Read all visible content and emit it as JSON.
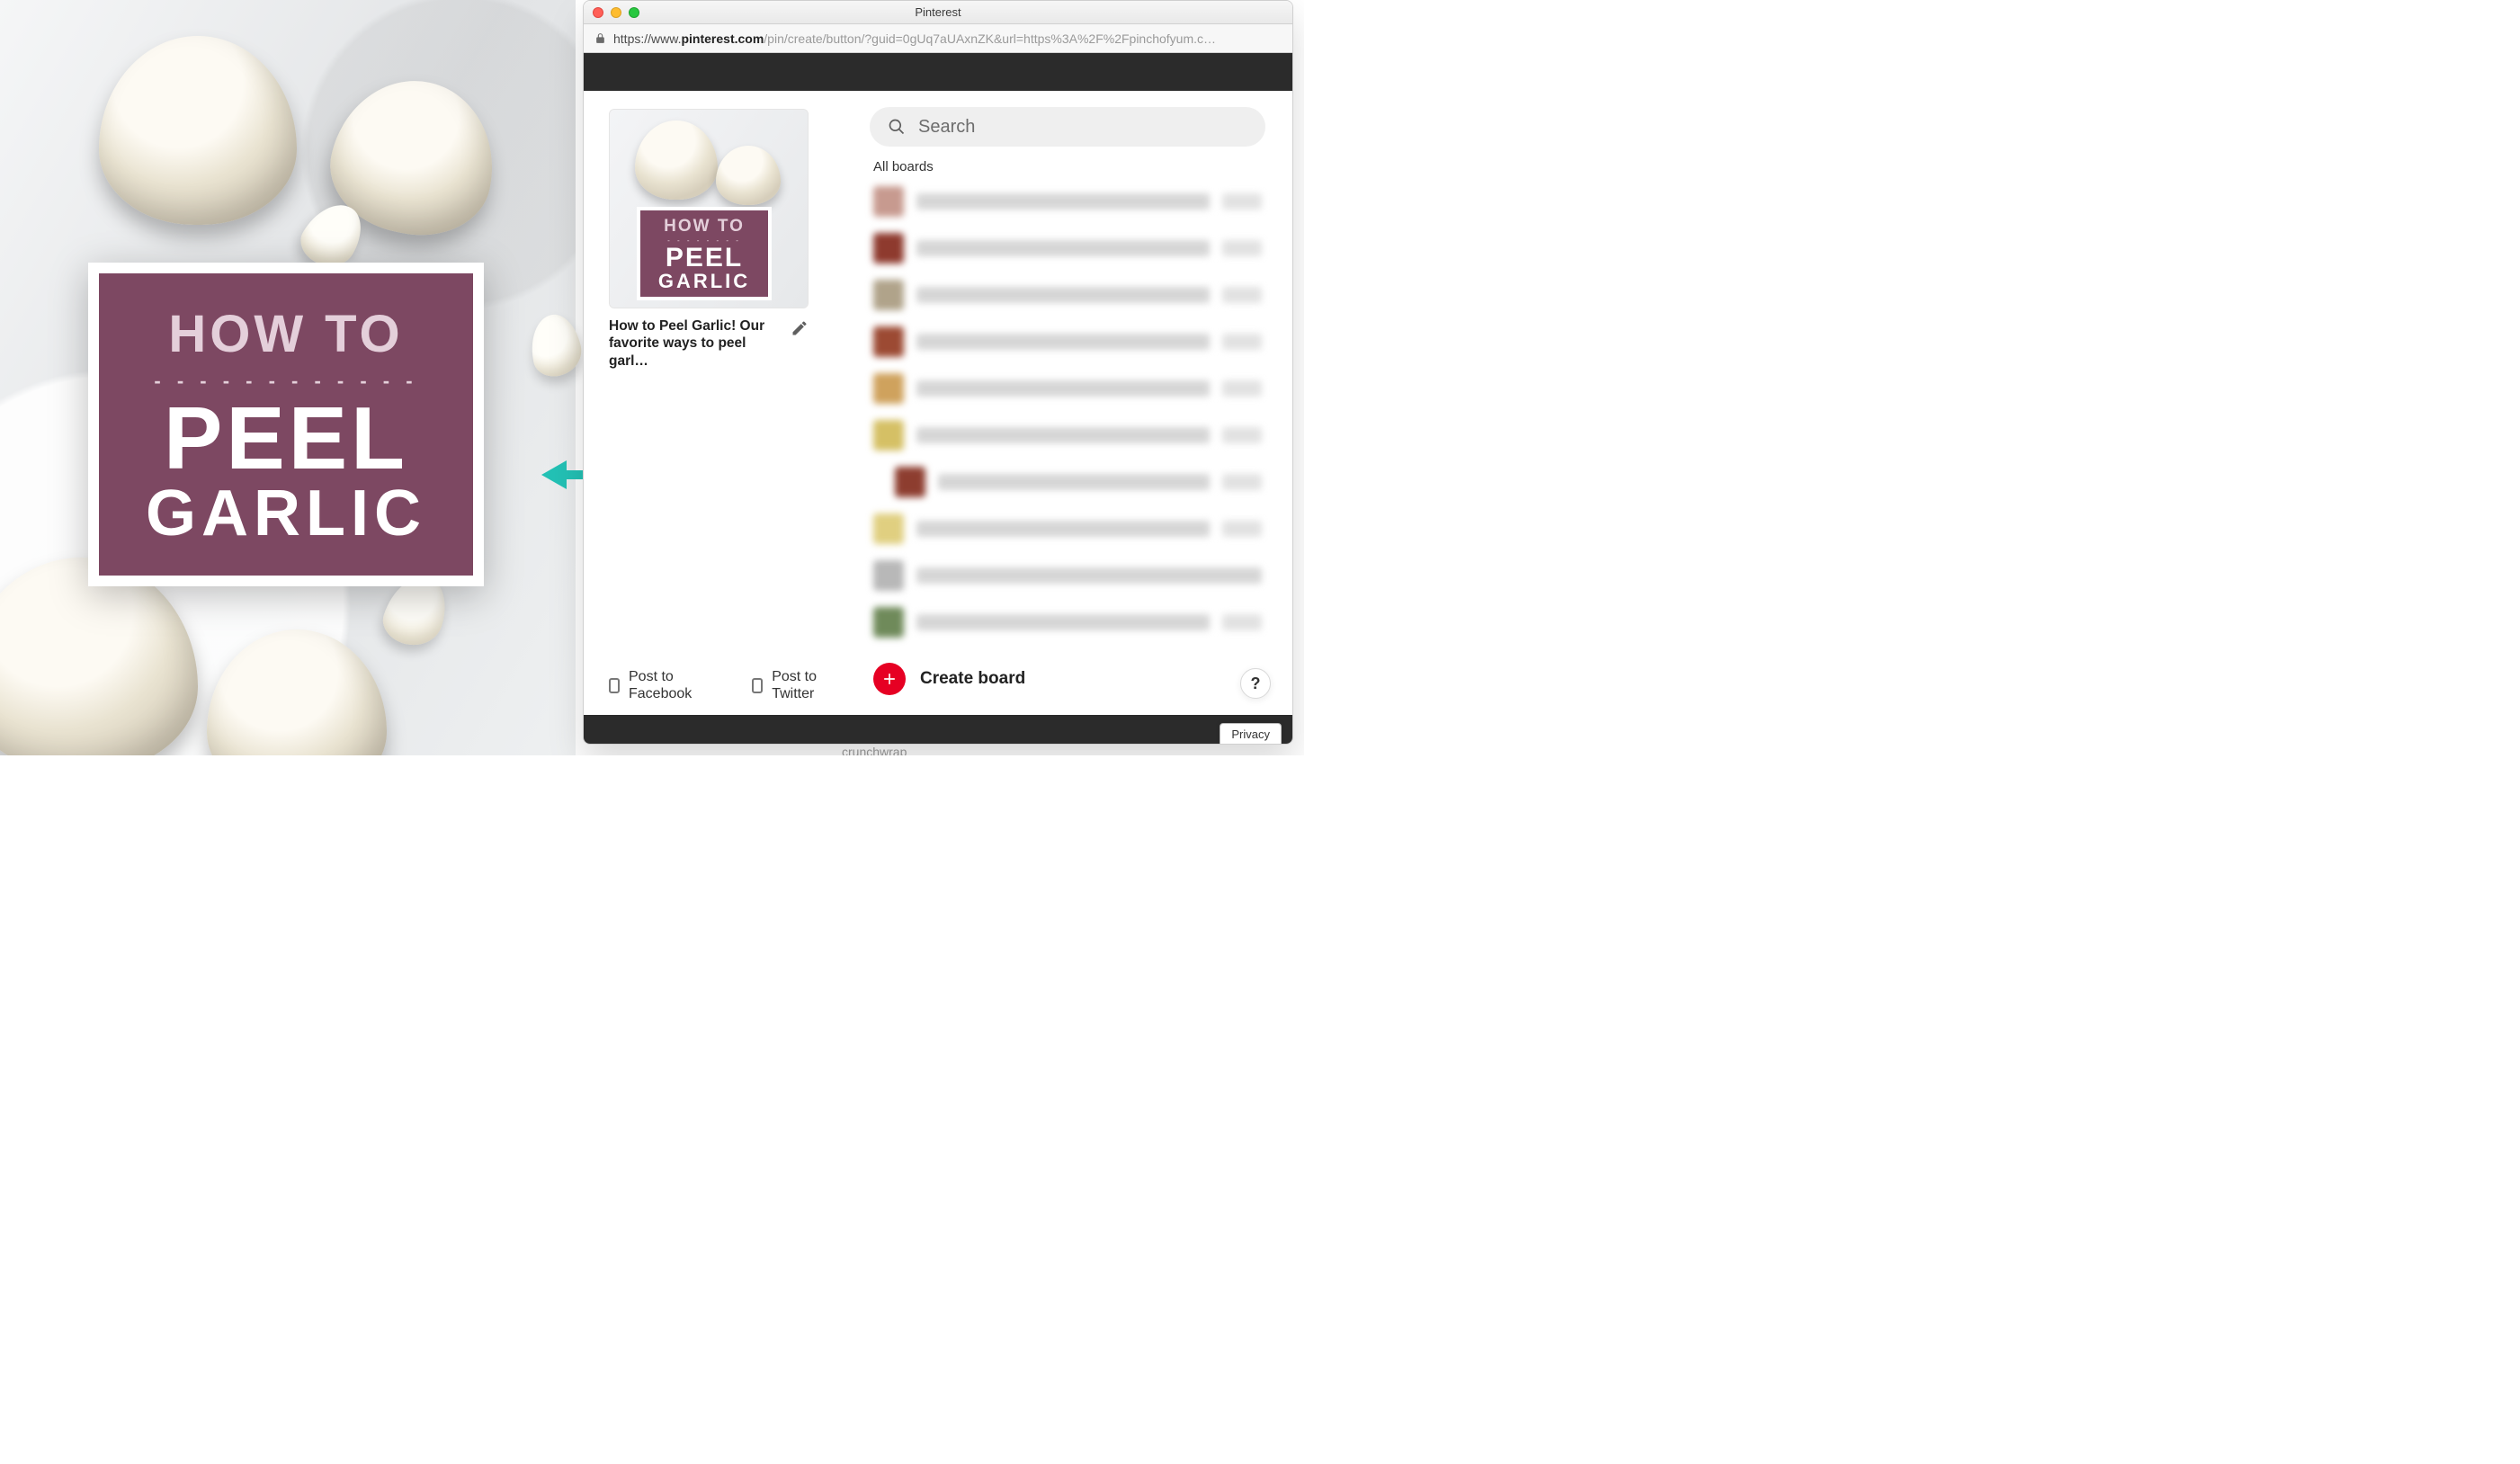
{
  "colors": {
    "badge_bg": "#7d4862",
    "arrow": "#23c1b5",
    "pinterest_red": "#e60023"
  },
  "photo": {
    "badge": {
      "line1": "HOW TO",
      "line2": "PEEL",
      "line3": "GARLIC"
    }
  },
  "browser": {
    "title": "Pinterest",
    "url_prefix": "https://",
    "url_host_pre": "www.",
    "url_host_bold": "pinterest.com",
    "url_path": "/pin/create/button/?guid=0gUq7aUAxnZK&url=https%3A%2F%2Fpinchofyum.c…"
  },
  "pin": {
    "thumb_badge": {
      "line1": "HOW TO",
      "line2": "PEEL",
      "line3": "GARLIC"
    },
    "caption": "How to Peel Garlic! Our favorite ways to peel garl…"
  },
  "share": {
    "facebook": "Post to Facebook",
    "twitter": "Post to Twitter"
  },
  "search": {
    "placeholder": "Search"
  },
  "boards": {
    "label": "All boards",
    "rows": [
      {
        "thumb": "#c79a8f",
        "name": "#d6d6d6",
        "sub": false,
        "save": true
      },
      {
        "thumb": "#8e3a2e",
        "name": "#d6d6d6",
        "sub": false,
        "save": true
      },
      {
        "thumb": "#b0a38a",
        "name": "#d6d6d6",
        "sub": false,
        "save": true
      },
      {
        "thumb": "#9c4a33",
        "name": "#d6d6d6",
        "sub": false,
        "save": true
      },
      {
        "thumb": "#cfa25d",
        "name": "#d6d6d6",
        "sub": false,
        "save": true
      },
      {
        "thumb": "#d5c065",
        "name": "#d6d6d6",
        "sub": false,
        "save": true
      },
      {
        "thumb": "#8d3d2f",
        "name": "#d6d6d6",
        "sub": true,
        "save": true
      },
      {
        "thumb": "#e0cf80",
        "name": "#d6d6d6",
        "sub": false,
        "save": true
      },
      {
        "thumb": "#b8b8b8",
        "name": "#d6d6d6",
        "sub": false,
        "save": false
      },
      {
        "thumb": "#6f8a5a",
        "name": "#d6d6d6",
        "sub": false,
        "save": true
      }
    ]
  },
  "create": {
    "label": "Create board"
  },
  "help": {
    "glyph": "?"
  },
  "privacy": {
    "label": "Privacy"
  },
  "stray": {
    "crunchwrap": "crunchwrap"
  }
}
